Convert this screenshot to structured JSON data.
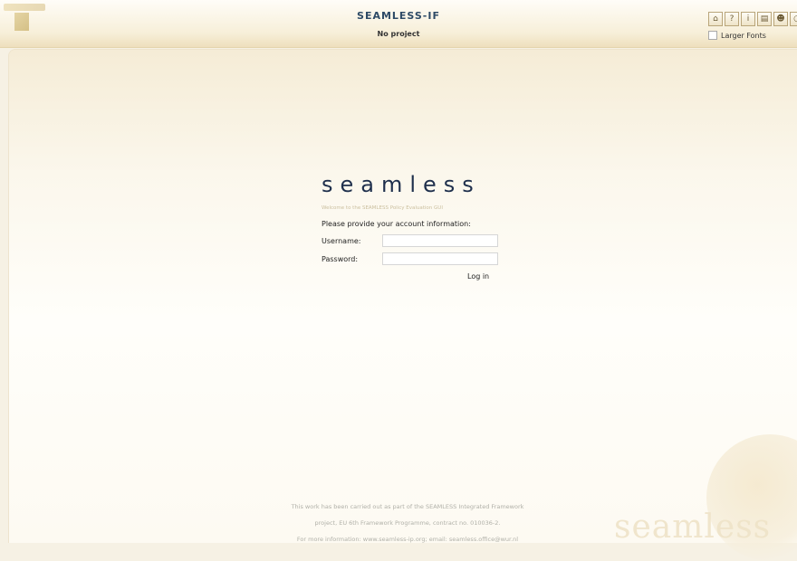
{
  "header": {
    "app_title": "SEAMLESS-IF",
    "project": "No project",
    "toolbar_icons": [
      "home-icon",
      "help-icon",
      "info-icon",
      "document-icon",
      "users-icon",
      "close-icon"
    ],
    "larger_fonts_label": "Larger Fonts",
    "larger_fonts_checked": false
  },
  "login": {
    "brand": "seamless",
    "welcome": "Welcome to the SEAMLESS Policy Evaluation GUI",
    "instructions": "Please provide your account information:",
    "username_label": "Username:",
    "username_value": "",
    "password_label": "Password:",
    "password_value": "",
    "login_label": "Log in"
  },
  "footer": {
    "line1": "This work has been carried out as part of the SEAMLESS Integrated Framework",
    "line2": "project, EU 6th Framework Programme, contract no. 010036-2.",
    "line3": "For more information: www.seamless-ip.org; email: seamless.office@wur.nl"
  },
  "watermark": "seamless",
  "colors": {
    "accent": "#1e2f4c",
    "header_bg": "#f7efd9",
    "panel_bg": "#fffefa"
  }
}
